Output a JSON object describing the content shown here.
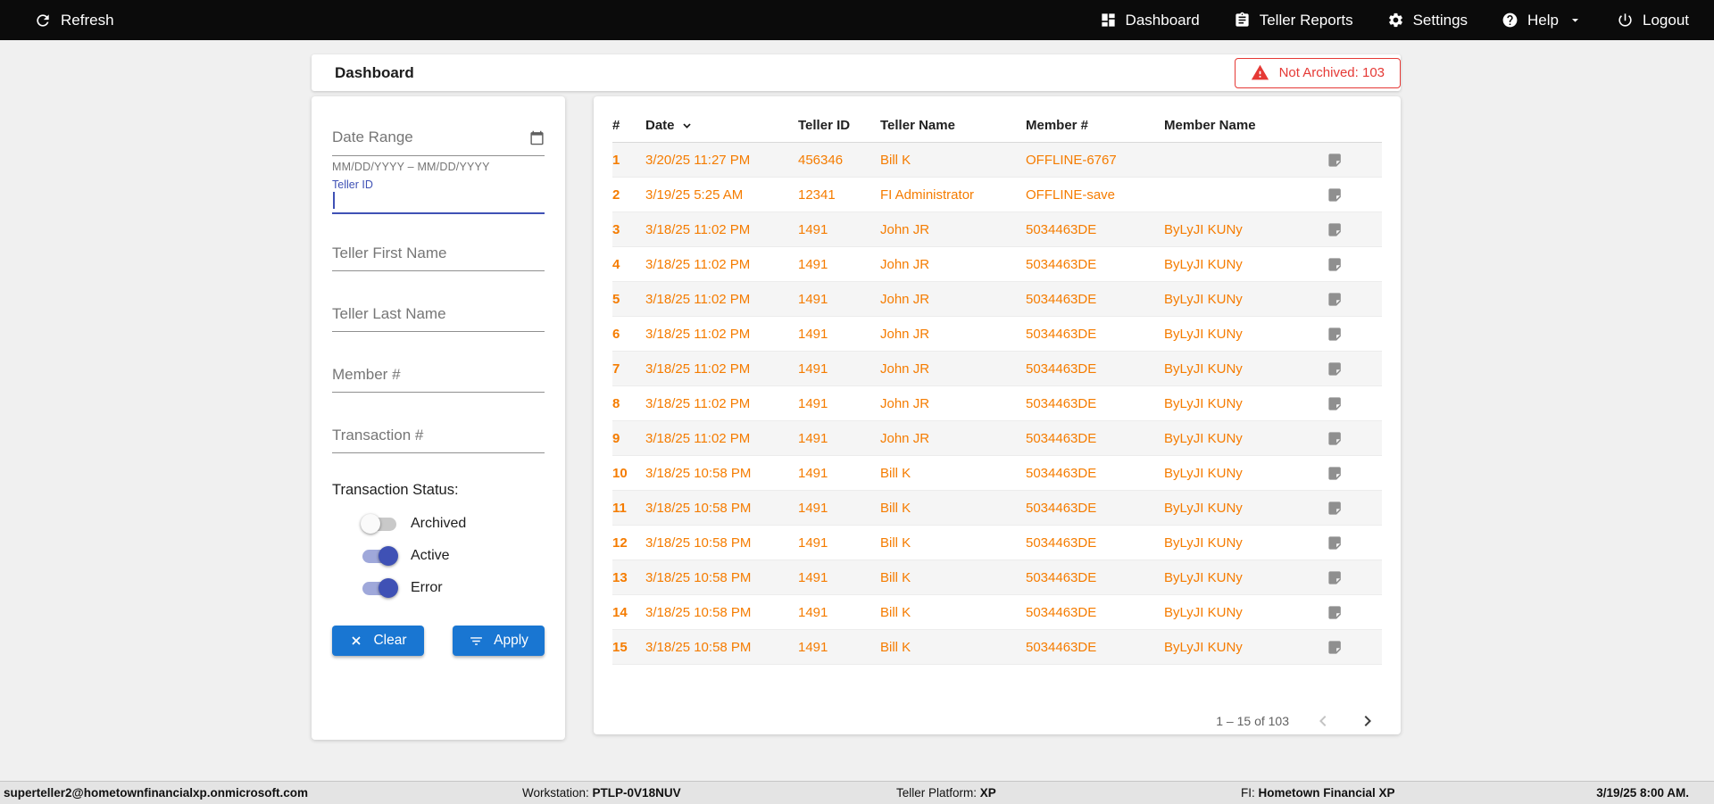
{
  "topbar": {
    "refresh_label": "Refresh",
    "nav": [
      {
        "label": "Dashboard"
      },
      {
        "label": "Teller Reports"
      },
      {
        "label": "Settings"
      },
      {
        "label": "Help"
      },
      {
        "label": "Logout"
      }
    ]
  },
  "header": {
    "title": "Dashboard",
    "not_archived_badge": "Not Archived: 103"
  },
  "filters": {
    "date_range_placeholder": "Date Range",
    "date_range_helper": "MM/DD/YYYY – MM/DD/YYYY",
    "teller_id_label": "Teller ID",
    "teller_first_name_placeholder": "Teller First Name",
    "teller_last_name_placeholder": "Teller Last Name",
    "member_number_placeholder": "Member #",
    "transaction_number_placeholder": "Transaction #",
    "status_label": "Transaction Status:",
    "toggles": [
      {
        "label": "Archived",
        "on": false
      },
      {
        "label": "Active",
        "on": true
      },
      {
        "label": "Error",
        "on": true
      }
    ],
    "clear_label": "Clear",
    "apply_label": "Apply"
  },
  "table": {
    "columns": [
      "#",
      "Date",
      "Teller ID",
      "Teller Name",
      "Member #",
      "Member Name"
    ],
    "rows": [
      {
        "num": "1",
        "date": "3/20/25 11:27 PM",
        "teller_id": "456346",
        "teller_name": "Bill K",
        "member_num": "OFFLINE-6767",
        "member_name": ""
      },
      {
        "num": "2",
        "date": "3/19/25 5:25 AM",
        "teller_id": "12341",
        "teller_name": "FI Administrator",
        "member_num": "OFFLINE-save",
        "member_name": ""
      },
      {
        "num": "3",
        "date": "3/18/25 11:02 PM",
        "teller_id": "1491",
        "teller_name": "John JR",
        "member_num": "5034463DE",
        "member_name": "ByLyJI KUNy"
      },
      {
        "num": "4",
        "date": "3/18/25 11:02 PM",
        "teller_id": "1491",
        "teller_name": "John JR",
        "member_num": "5034463DE",
        "member_name": "ByLyJI KUNy"
      },
      {
        "num": "5",
        "date": "3/18/25 11:02 PM",
        "teller_id": "1491",
        "teller_name": "John JR",
        "member_num": "5034463DE",
        "member_name": "ByLyJI KUNy"
      },
      {
        "num": "6",
        "date": "3/18/25 11:02 PM",
        "teller_id": "1491",
        "teller_name": "John JR",
        "member_num": "5034463DE",
        "member_name": "ByLyJI KUNy"
      },
      {
        "num": "7",
        "date": "3/18/25 11:02 PM",
        "teller_id": "1491",
        "teller_name": "John JR",
        "member_num": "5034463DE",
        "member_name": "ByLyJI KUNy"
      },
      {
        "num": "8",
        "date": "3/18/25 11:02 PM",
        "teller_id": "1491",
        "teller_name": "John JR",
        "member_num": "5034463DE",
        "member_name": "ByLyJI KUNy"
      },
      {
        "num": "9",
        "date": "3/18/25 11:02 PM",
        "teller_id": "1491",
        "teller_name": "John JR",
        "member_num": "5034463DE",
        "member_name": "ByLyJI KUNy"
      },
      {
        "num": "10",
        "date": "3/18/25 10:58 PM",
        "teller_id": "1491",
        "teller_name": "Bill K",
        "member_num": "5034463DE",
        "member_name": "ByLyJI KUNy"
      },
      {
        "num": "11",
        "date": "3/18/25 10:58 PM",
        "teller_id": "1491",
        "teller_name": "Bill K",
        "member_num": "5034463DE",
        "member_name": "ByLyJI KUNy"
      },
      {
        "num": "12",
        "date": "3/18/25 10:58 PM",
        "teller_id": "1491",
        "teller_name": "Bill K",
        "member_num": "5034463DE",
        "member_name": "ByLyJI KUNy"
      },
      {
        "num": "13",
        "date": "3/18/25 10:58 PM",
        "teller_id": "1491",
        "teller_name": "Bill K",
        "member_num": "5034463DE",
        "member_name": "ByLyJI KUNy"
      },
      {
        "num": "14",
        "date": "3/18/25 10:58 PM",
        "teller_id": "1491",
        "teller_name": "Bill K",
        "member_num": "5034463DE",
        "member_name": "ByLyJI KUNy"
      },
      {
        "num": "15",
        "date": "3/18/25 10:58 PM",
        "teller_id": "1491",
        "teller_name": "Bill K",
        "member_num": "5034463DE",
        "member_name": "ByLyJI KUNy"
      }
    ],
    "pagination": {
      "range_label": "1 – 15 of 103"
    }
  },
  "footer": {
    "user_email": "superteller2@hometownfinancialxp.onmicrosoft.com",
    "workstation_label": "Workstation:",
    "workstation_value": "PTLP-0V18NUV",
    "platform_label": "Teller Platform:",
    "platform_value": "XP",
    "fi_label": "FI:",
    "fi_value": "Hometown Financial XP",
    "datetime": "3/19/25 8:00 AM."
  },
  "colors": {
    "accent_orange": "#F57C00",
    "button_blue": "#1976D2",
    "toggle_blue": "#3F51B5",
    "alert_red": "#E53935"
  },
  "icons": {
    "topbar": [
      "refresh-icon",
      "dashboard-icon",
      "reports-icon",
      "gear-icon",
      "help-icon",
      "chevron-down-icon",
      "power-icon"
    ],
    "header": [
      "warning-triangle-icon"
    ],
    "filters": [
      "calendar-icon",
      "clear-x-icon",
      "filter-icon"
    ],
    "table": [
      "sort-caret-icon",
      "note-icon",
      "chevron-left-icon",
      "chevron-right-icon"
    ]
  }
}
